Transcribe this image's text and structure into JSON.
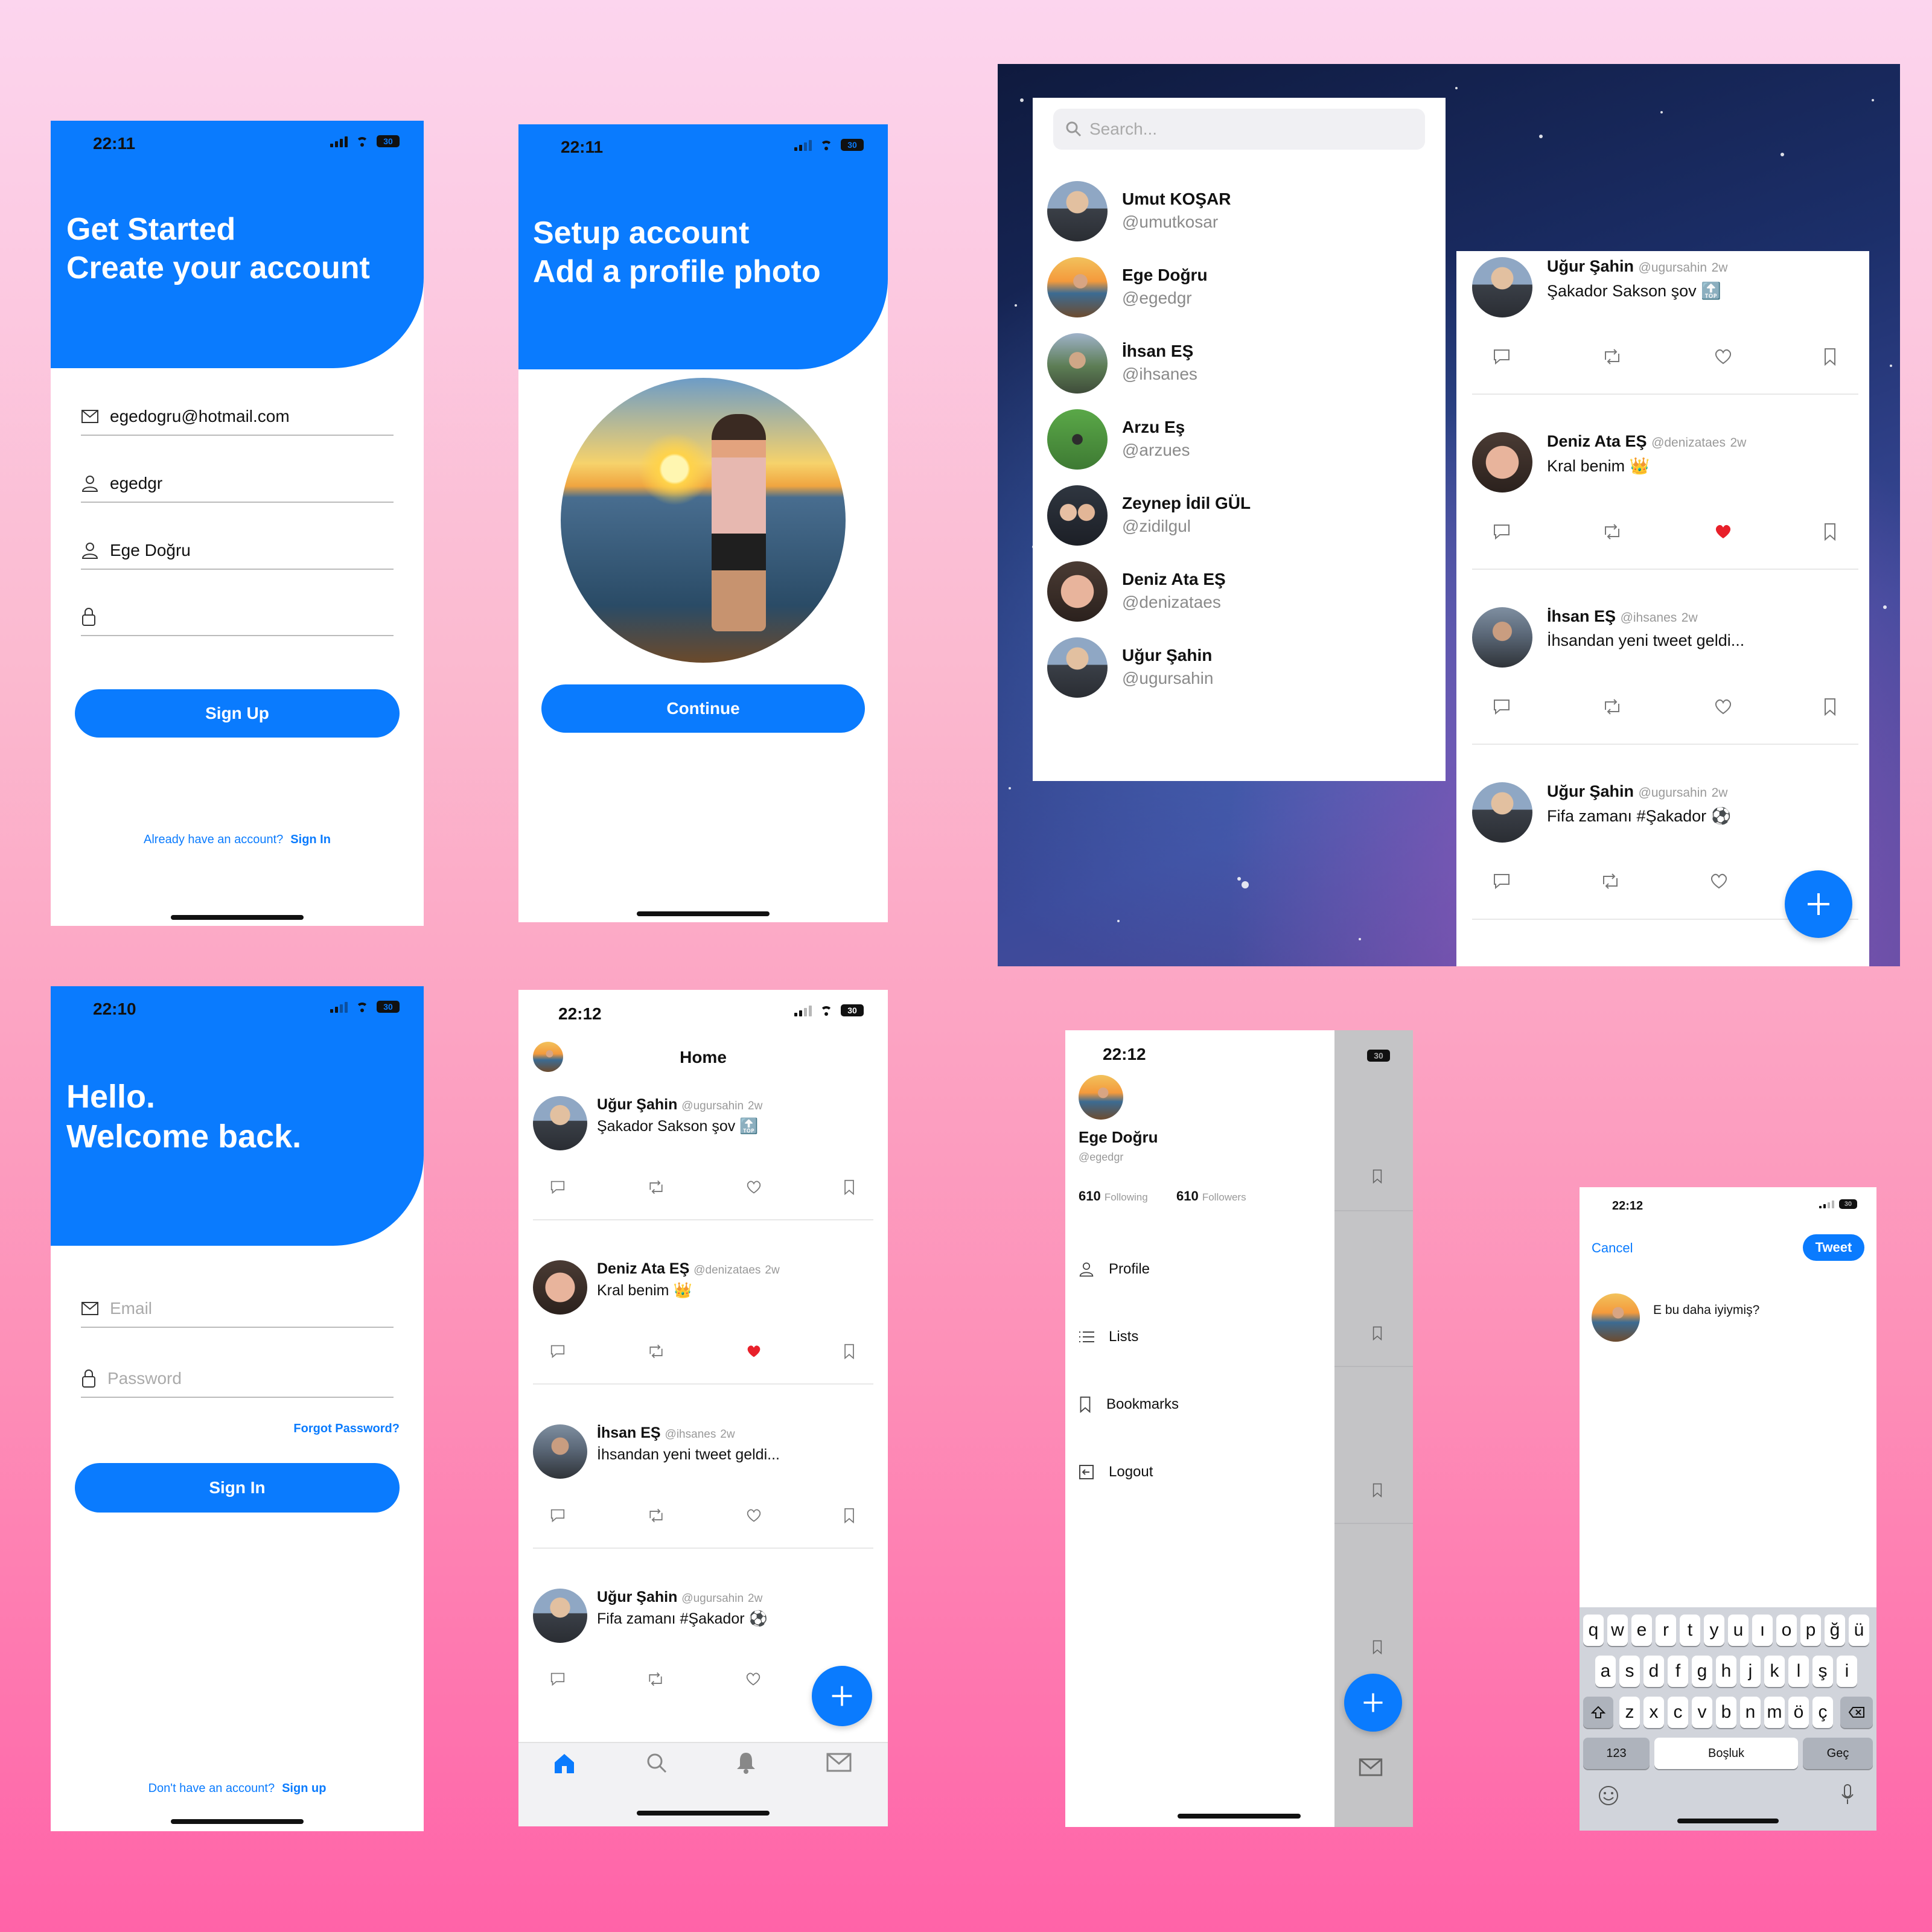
{
  "signup": {
    "time": "22:11",
    "battery": "30",
    "title_line1": "Get Started",
    "title_line2": "Create your account",
    "email_value": "egedogru@hotmail.com",
    "username_value": "egedgr",
    "fullname_value": "Ege Doğru",
    "password_value": "",
    "button": "Sign Up",
    "footer_text": "Already have an account?",
    "footer_link": "Sign In"
  },
  "setup": {
    "time": "22:11",
    "battery": "30",
    "title_line1": "Setup account",
    "title_line2": "Add a profile photo",
    "button": "Continue"
  },
  "explore": {
    "search_placeholder": "Search...",
    "users": [
      {
        "name": "Umut KOŞAR",
        "handle": "@umutkosar"
      },
      {
        "name": "Ege Doğru",
        "handle": "@egedgr"
      },
      {
        "name": "İhsan EŞ",
        "handle": "@ihsanes"
      },
      {
        "name": "Arzu Eş",
        "handle": "@arzues"
      },
      {
        "name": "Zeynep İdil GÜL",
        "handle": "@zidilgul"
      },
      {
        "name": "Deniz Ata EŞ",
        "handle": "@denizataes"
      },
      {
        "name": "Uğur Şahin",
        "handle": "@ugursahin"
      }
    ]
  },
  "tweets": [
    {
      "name": "Uğur Şahin",
      "handle": "@ugursahin",
      "age": "2w",
      "text": "Şakador Sakson şov 🔝",
      "liked": false
    },
    {
      "name": "Deniz Ata EŞ",
      "handle": "@denizataes",
      "age": "2w",
      "text": "Kral benim 👑",
      "liked": true
    },
    {
      "name": "İhsan EŞ",
      "handle": "@ihsanes",
      "age": "2w",
      "text": "İhsandan yeni tweet geldi...",
      "liked": false
    },
    {
      "name": "Uğur Şahin",
      "handle": "@ugursahin",
      "age": "2w",
      "text": "Fifa zamanı #Şakador ⚽",
      "liked": false
    }
  ],
  "login": {
    "time": "22:10",
    "battery": "30",
    "title_line1": "Hello.",
    "title_line2": "Welcome back.",
    "email_placeholder": "Email",
    "password_placeholder": "Password",
    "forgot": "Forgot Password?",
    "button": "Sign In",
    "footer_text": "Don't have an account?",
    "footer_link": "Sign up"
  },
  "home": {
    "time": "22:12",
    "battery": "30",
    "title": "Home"
  },
  "drawer": {
    "time": "22:12",
    "battery": "30",
    "name": "Ege Doğru",
    "handle": "@egedgr",
    "following_count": "610",
    "following_label": "Following",
    "followers_count": "610",
    "followers_label": "Followers",
    "menu": [
      {
        "label": "Profile",
        "icon": "person-icon"
      },
      {
        "label": "Lists",
        "icon": "list-icon"
      },
      {
        "label": "Bookmarks",
        "icon": "bookmark-icon"
      },
      {
        "label": "Logout",
        "icon": "logout-icon"
      }
    ]
  },
  "compose": {
    "time": "22:12",
    "battery": "30",
    "cancel": "Cancel",
    "tweet_button": "Tweet",
    "draft_text": "E bu daha iyiymiş?",
    "keyboard_row1": [
      "q",
      "w",
      "e",
      "r",
      "t",
      "y",
      "u",
      "ı",
      "o",
      "p",
      "ğ",
      "ü"
    ],
    "keyboard_row2": [
      "a",
      "s",
      "d",
      "f",
      "g",
      "h",
      "j",
      "k",
      "l",
      "ş",
      "i"
    ],
    "keyboard_row3": [
      "z",
      "x",
      "c",
      "v",
      "b",
      "n",
      "m",
      "ö",
      "ç"
    ],
    "key_numbers": "123",
    "key_space": "Boşluk",
    "key_go": "Geç"
  },
  "colors": {
    "accent": "#0a7bfe",
    "like": "#e8202a"
  }
}
